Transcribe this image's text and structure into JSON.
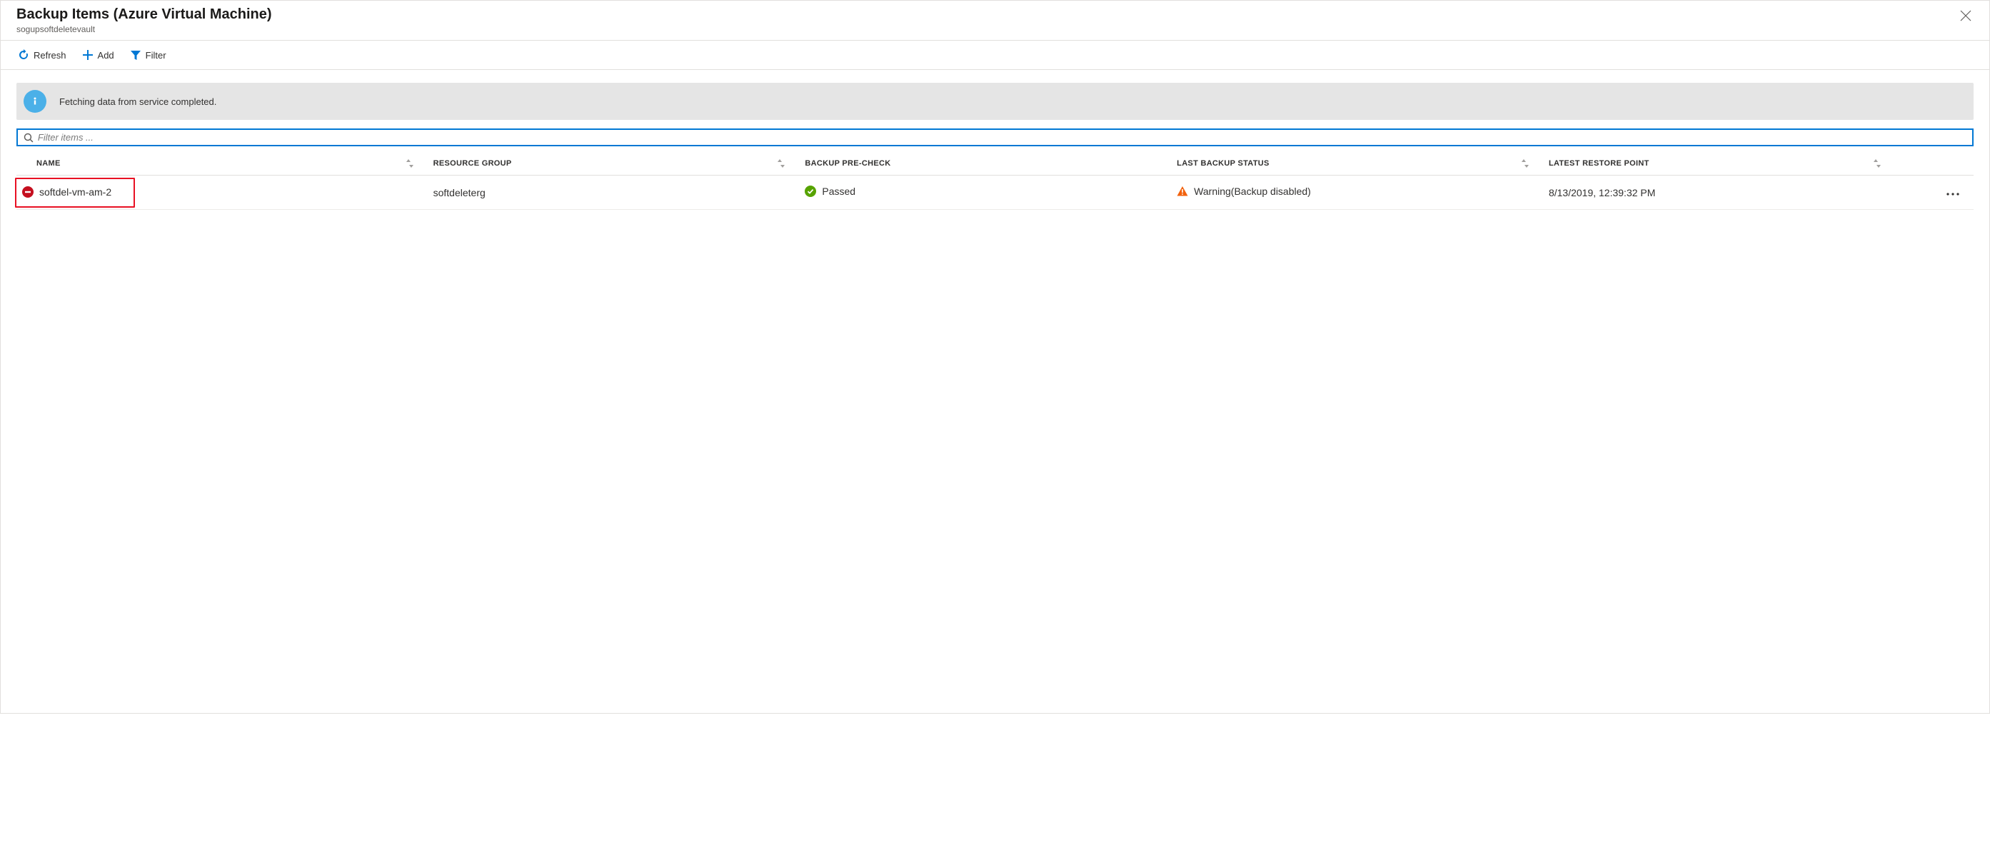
{
  "header": {
    "title": "Backup Items (Azure Virtual Machine)",
    "subtitle": "sogupsoftdeletevault"
  },
  "toolbar": {
    "refresh_label": "Refresh",
    "add_label": "Add",
    "filter_label": "Filter"
  },
  "info": {
    "text": "Fetching data from service completed."
  },
  "filter": {
    "placeholder": "Filter items ..."
  },
  "columns": {
    "name": "Name",
    "resource_group": "Resource Group",
    "precheck": "Backup Pre-Check",
    "last_status": "Last Backup Status",
    "latest_restore": "Latest Restore Point"
  },
  "rows": [
    {
      "name": "softdel-vm-am-2",
      "resource_group": "softdeleterg",
      "precheck": "Passed",
      "last_status": "Warning(Backup disabled)",
      "latest_restore": "8/13/2019, 12:39:32 PM"
    }
  ]
}
